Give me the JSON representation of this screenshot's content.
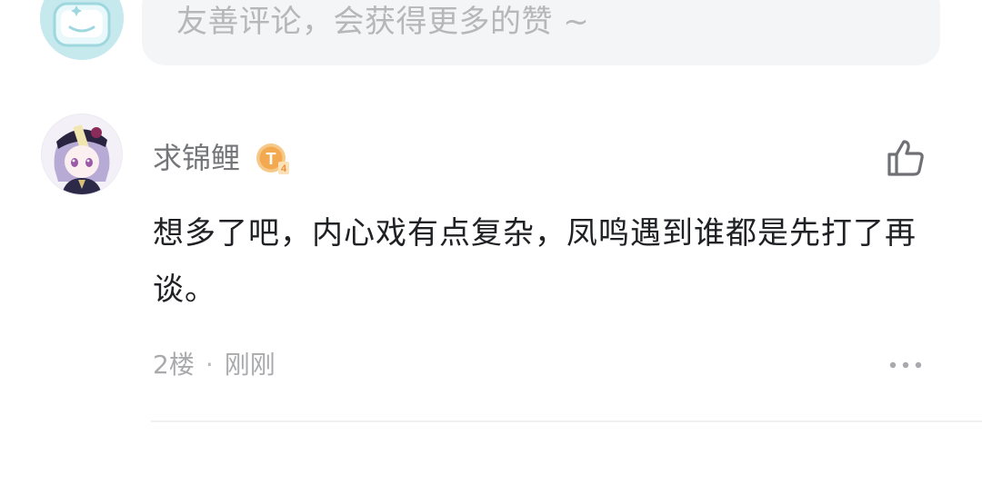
{
  "composer": {
    "placeholder": "友善评论，会获得更多的赞 ~"
  },
  "comment": {
    "username": "求锦鲤",
    "level_badge_text": "T4",
    "body": "想多了吧，内心戏有点复杂，凤鸣遇到谁都是先打了再谈。",
    "floor": "2楼",
    "separator": "·",
    "time": "刚刚",
    "icons": {
      "like": "thumbs-up-icon",
      "more": "more-dots-icon",
      "badge": "level-badge-icon"
    }
  },
  "colors": {
    "placeholder_text": "#b6b7b9",
    "input_background": "#f4f5f6",
    "username": "#75767a",
    "body_text": "#202124",
    "meta_text": "#a9aaad",
    "badge_orange": "#f3a94f",
    "avatar_bg_teal": "#d9f0f3"
  }
}
